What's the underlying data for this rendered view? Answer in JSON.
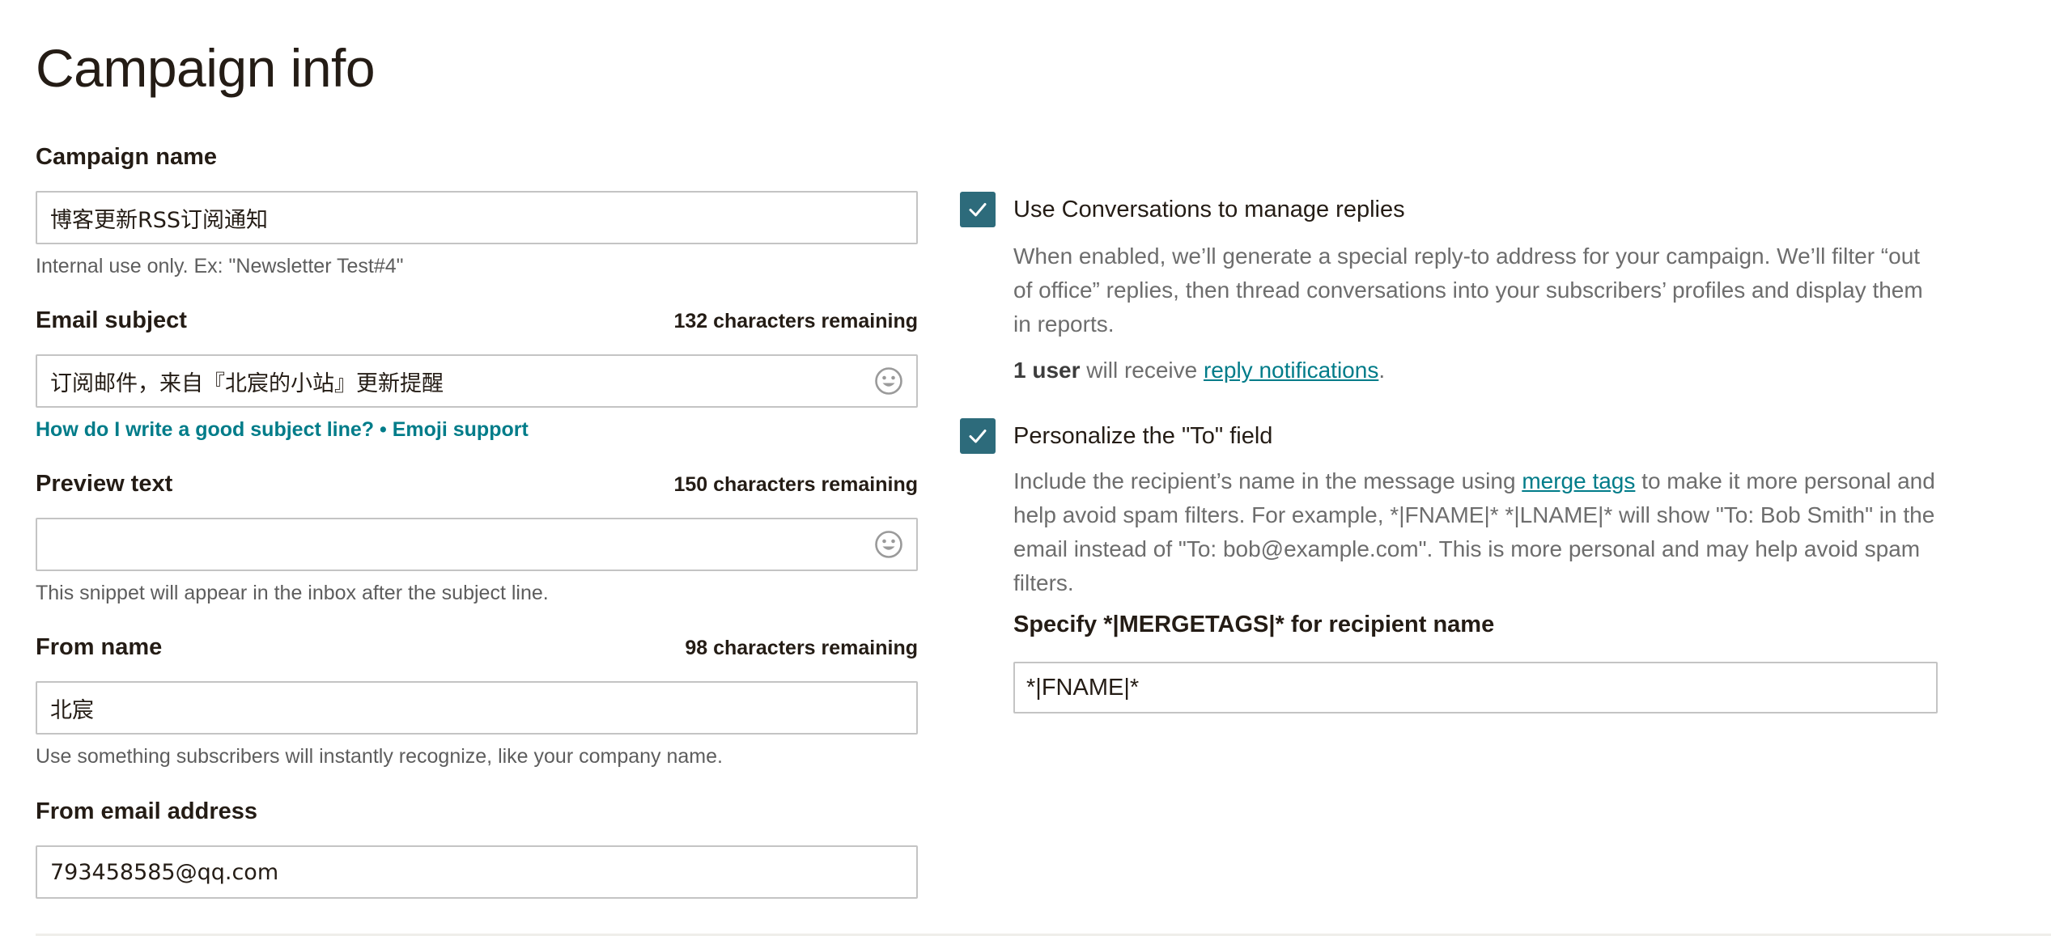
{
  "page": {
    "title": "Campaign info"
  },
  "campaign_name": {
    "label": "Campaign name",
    "value": "博客更新RSS订阅通知",
    "help": "Internal use only. Ex: \"Newsletter Test#4\""
  },
  "email_subject": {
    "label": "Email subject",
    "counter": "132 characters remaining",
    "value": "订阅邮件，来自『北宸的小站』更新提醒",
    "help_link_1": "How do I write a good subject line?",
    "help_separator": " • ",
    "help_link_2": "Emoji support",
    "emoji_icon": "smiley-icon"
  },
  "preview_text": {
    "label": "Preview text",
    "counter": "150 characters remaining",
    "value": "",
    "help": "This snippet will appear in the inbox after the subject line.",
    "emoji_icon": "smiley-icon"
  },
  "from_name": {
    "label": "From name",
    "counter": "98 characters remaining",
    "value": "北宸",
    "help": "Use something subscribers will instantly recognize, like your company name."
  },
  "from_email": {
    "label": "From email address",
    "value": "793458585@qq.com"
  },
  "conversations": {
    "checked": true,
    "label": "Use Conversations to manage replies",
    "description": "When enabled, we’ll generate a special reply-to address for your campaign. We’ll filter “out of office” replies, then thread conversations into your subscribers’ profiles and display them in reports.",
    "user_count": "1 user",
    "user_text": " will receive ",
    "notifications_link": "reply notifications",
    "period": "."
  },
  "personalize": {
    "checked": true,
    "label": "Personalize the \"To\" field",
    "desc_before": "Include the recipient’s name in the message using ",
    "merge_tags_link": "merge tags",
    "desc_after": " to make it more personal and help avoid spam filters. For example, *|FNAME|* *|LNAME|* will show \"To: Bob Smith\" in the email instead of \"To: bob@example.com\". This is more personal and may help avoid spam filters.",
    "merge_label": "Specify *|MERGETAGS|* for recipient name",
    "merge_value": "*|FNAME|*"
  },
  "colors": {
    "checkbox": "#2d6b7b",
    "link": "#007c89",
    "text": "#241c15",
    "muted": "#6d6d6d",
    "border": "#c4c4c4"
  }
}
